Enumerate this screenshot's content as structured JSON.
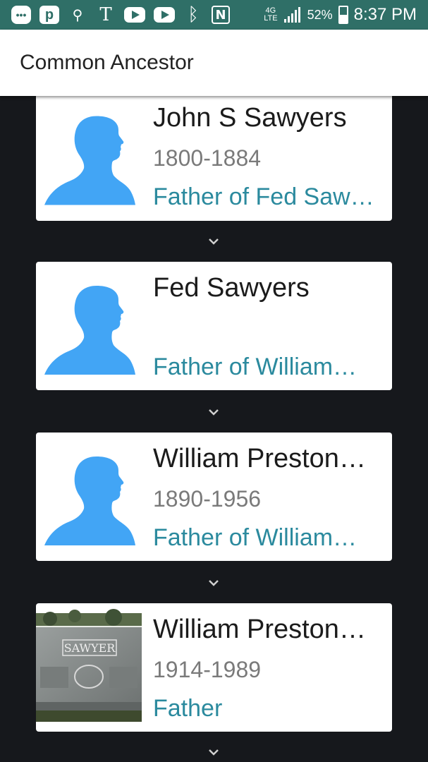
{
  "status_bar": {
    "battery": "52%",
    "time": "8:37 PM",
    "network": "4G LTE",
    "icons": [
      "messages-icon",
      "pinterest-icon",
      "usb-icon",
      "tmobile-icon",
      "youtube-icon",
      "youtube-icon",
      "bluetooth-icon",
      "nfc-icon",
      "network-4g-icon",
      "signal-icon",
      "battery-icon"
    ]
  },
  "app_bar": {
    "title": "Common Ancestor"
  },
  "cards": [
    {
      "name": "John S Sawyers",
      "years": "1800-1884",
      "relation": "Father of Fed Saw…",
      "image": "silhouette"
    },
    {
      "name": "Fed Sawyers",
      "years": "",
      "relation": "Father of William…",
      "image": "silhouette"
    },
    {
      "name": "William Preston…",
      "years": "1890-1956",
      "relation": "Father of William…",
      "image": "silhouette"
    },
    {
      "name": "William Preston…",
      "years": "1914-1989",
      "relation": "Father",
      "image": "gravestone",
      "gravestone_text": "SAWYER"
    }
  ],
  "colors": {
    "status_bar": "#2f6f67",
    "accent": "#2b8a9e",
    "silhouette": "#42a5f5",
    "background": "#16181c"
  }
}
